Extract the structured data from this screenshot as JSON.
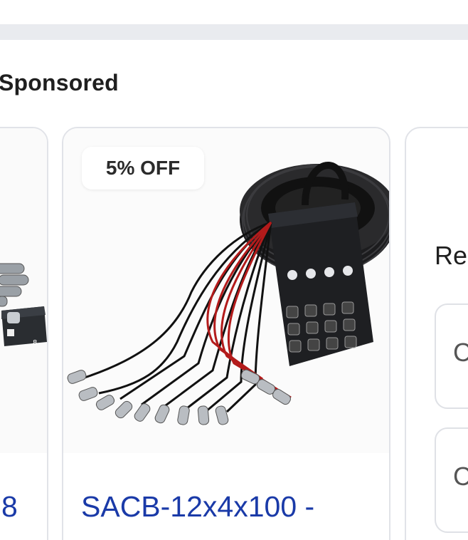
{
  "section": {
    "title": "Sponsored"
  },
  "cards": [
    {
      "title": "8"
    },
    {
      "badge": "5% OFF",
      "title": "SACB-12x4x100 -"
    }
  ],
  "right_card": {
    "label": "Re",
    "options": [
      "C",
      "C"
    ]
  },
  "colors": {
    "link": "#1a3aa8",
    "divider": "#e9ebef",
    "border": "#e1e3e8"
  }
}
